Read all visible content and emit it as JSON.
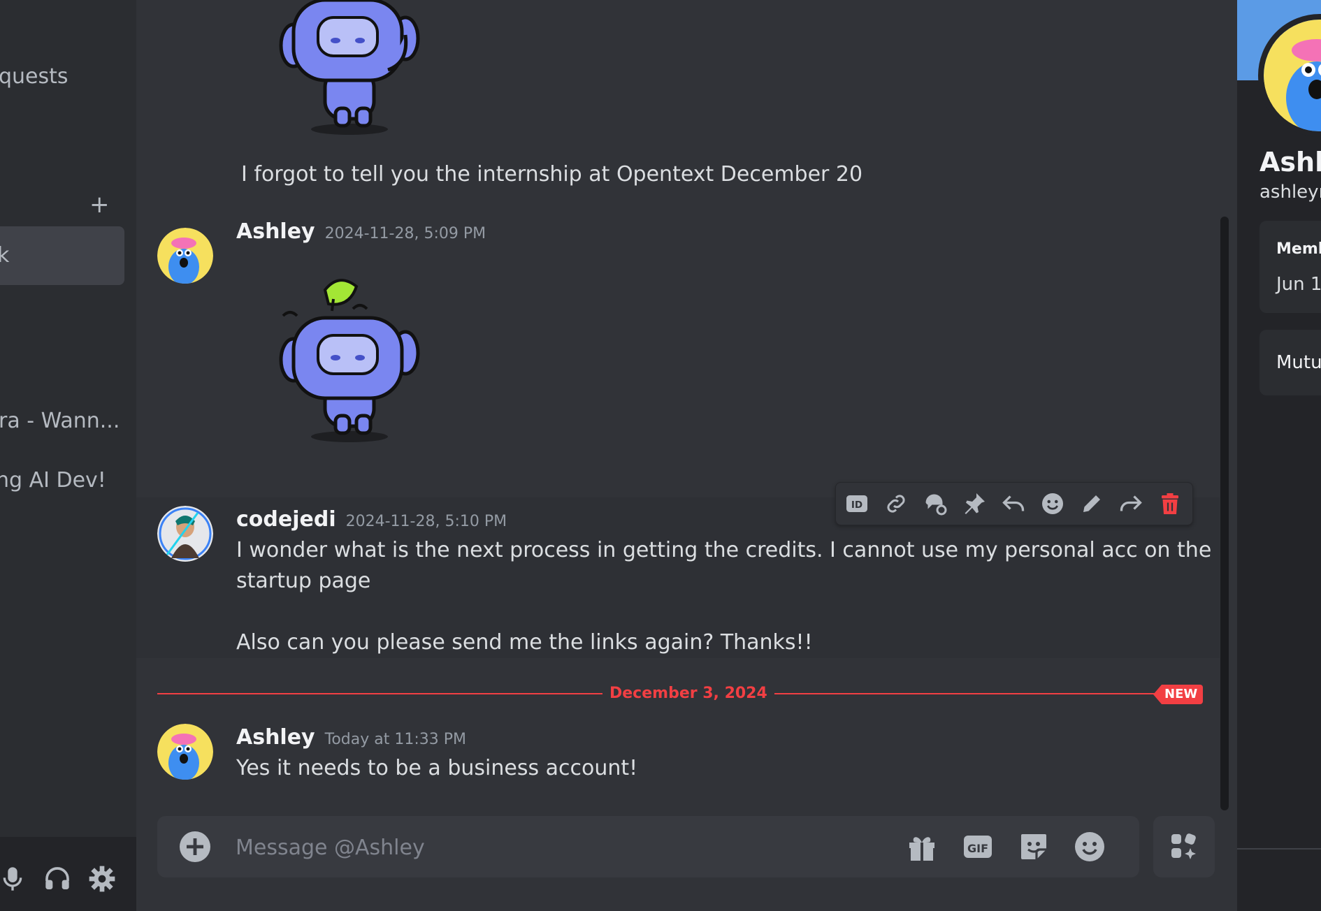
{
  "sidebar": {
    "items": [
      {
        "label": "quests"
      },
      {
        "label": "k"
      },
      {
        "label": "ra - Wann..."
      },
      {
        "label": "ng AI Dev!"
      }
    ],
    "add_label": "+"
  },
  "chat": {
    "messages": [
      {
        "kind": "sticker_continuation",
        "text": "I forgot to tell you the internship at Opentext December 20"
      },
      {
        "author": "Ashley",
        "timestamp": "2024-11-28, 5:09 PM",
        "sticker": "wumpus-wave"
      },
      {
        "author": "codejedi",
        "timestamp": "2024-11-28, 5:10 PM",
        "lines": [
          "I wonder what is the next process in getting the credits. I cannot use my personal acc on the",
          "startup page",
          "",
          "Also can you please send me the links again? Thanks!!"
        ]
      },
      {
        "author": "Ashley",
        "timestamp": "Today at 11:33 PM",
        "text": "Yes it needs to be a business account!"
      }
    ],
    "divider_date": "December 3, 2024",
    "new_badge": "NEW",
    "toolbar_icons": [
      "id-icon",
      "link-icon",
      "thread-icon",
      "pin-icon",
      "reply-icon",
      "reaction-icon",
      "edit-icon",
      "forward-icon",
      "delete-icon"
    ]
  },
  "composer": {
    "placeholder": "Message @Ashley",
    "gif_label": "GIF"
  },
  "profile": {
    "name": "Ashle",
    "username": "ashleyn",
    "member_since_label": "Memb",
    "member_since_value": "Jun 1",
    "mutual_label": "Mutu"
  },
  "colors": {
    "accent_red": "#f23f43",
    "background": "#313338",
    "sticker_blue": "#7a86f0"
  }
}
